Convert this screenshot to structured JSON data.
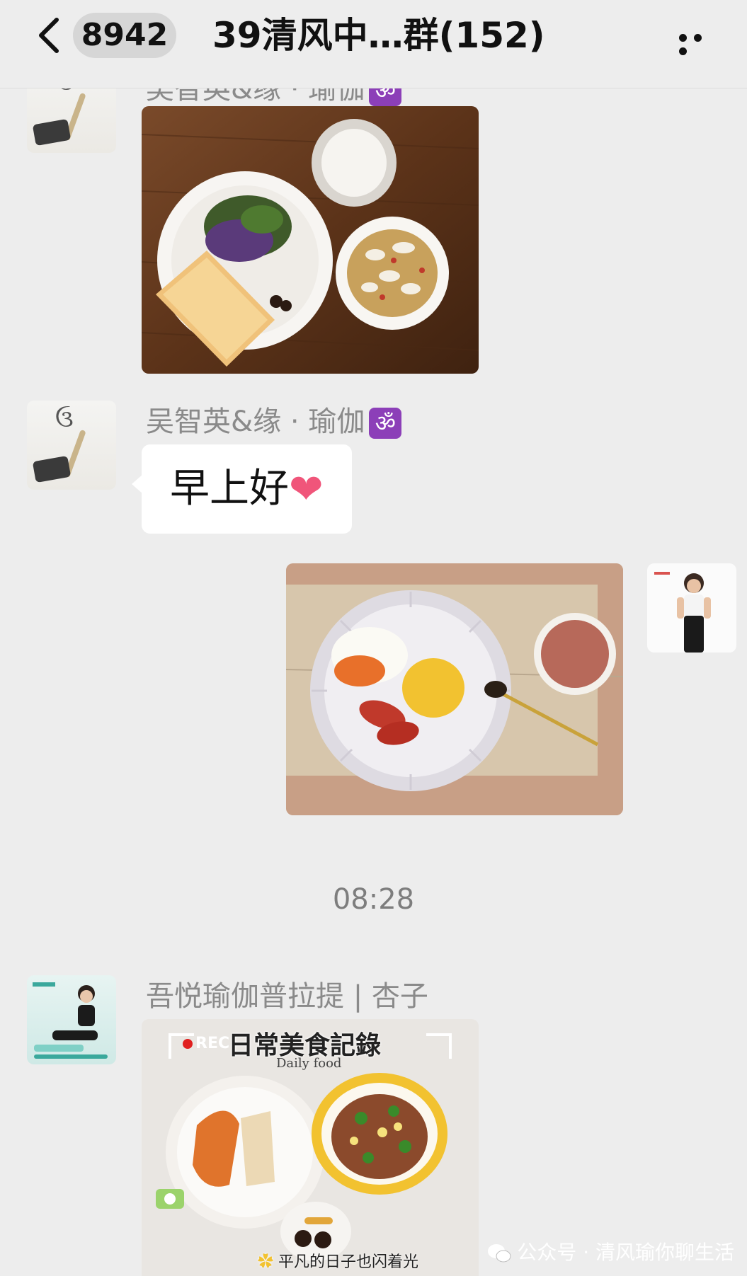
{
  "header": {
    "unread_count": "8942",
    "title": "39清风中…群(152)"
  },
  "messages": [
    {
      "sender": "吴智英&缘 · 瑜伽",
      "type": "image",
      "image_desc": "breakfast-plate-bread-greens-soup-milk"
    },
    {
      "sender": "吴智英&缘 · 瑜伽",
      "type": "text",
      "text": "早上好"
    },
    {
      "sender": "self",
      "type": "image",
      "image_desc": "breakfast-egg-tomato-bun-congee"
    },
    {
      "sender": "吾悦瑜伽普拉提 | 杏子",
      "type": "image",
      "overlay_title": "日常美食記錄",
      "overlay_subtitle": "Daily food",
      "overlay_rec": "REC",
      "overlay_caption": "平凡的日子也闪着光"
    }
  ],
  "time_divider": "08:28",
  "watermark": "公众号 · 清风瑜你聊生活",
  "om_symbol": "ॐ",
  "heart_symbol": "❤"
}
